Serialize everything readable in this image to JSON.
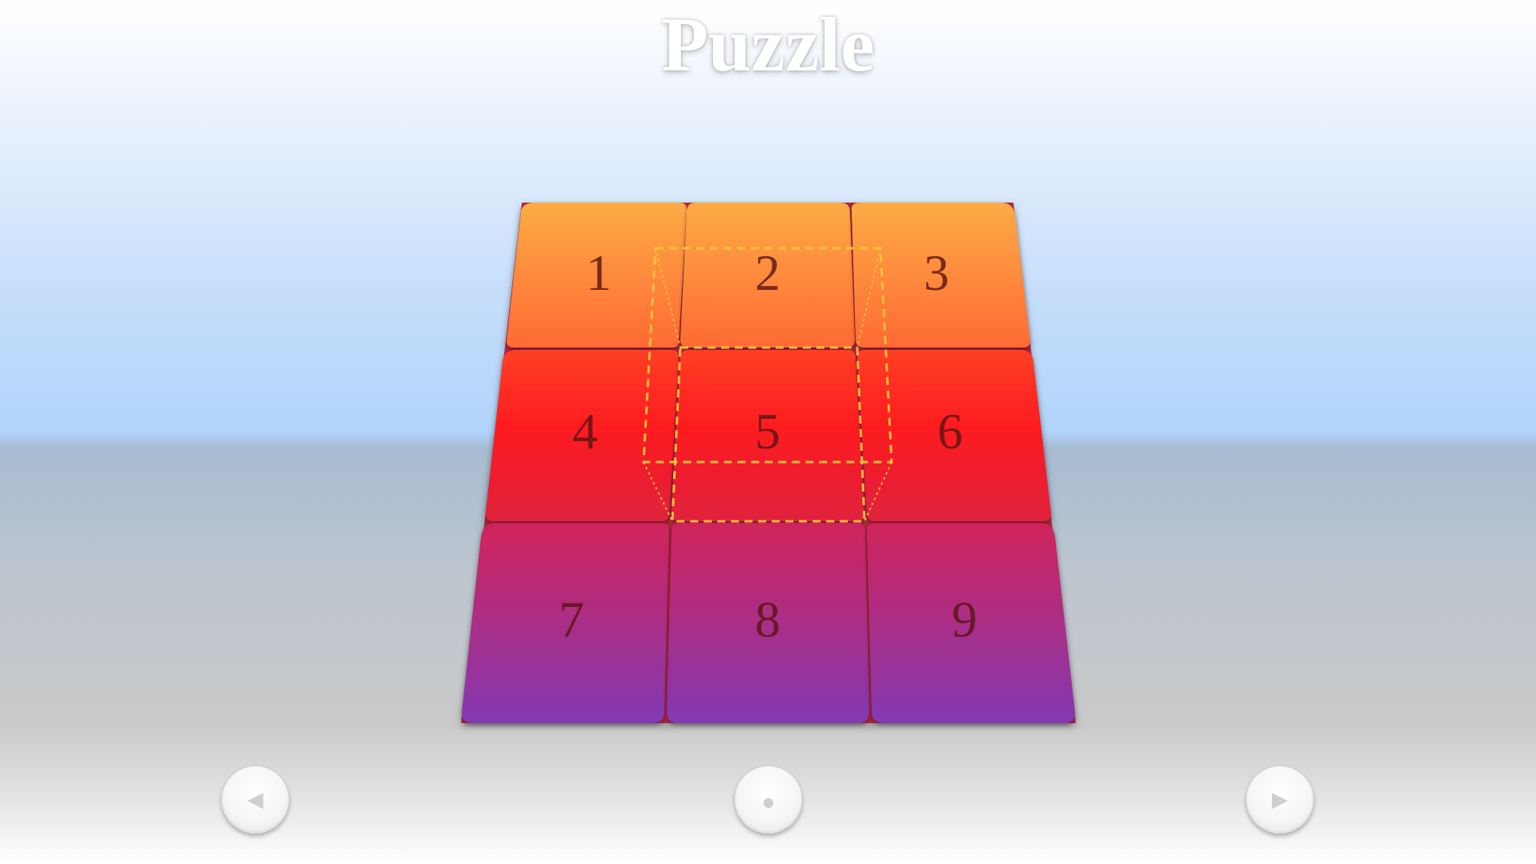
{
  "title": "Puzzle",
  "board": {
    "tiles": [
      {
        "label": "1"
      },
      {
        "label": "2"
      },
      {
        "label": "3"
      },
      {
        "label": "4"
      },
      {
        "label": "5"
      },
      {
        "label": "6"
      },
      {
        "label": "7"
      },
      {
        "label": "8"
      },
      {
        "label": "9"
      }
    ],
    "colors": {
      "orange_top": "#fcab45",
      "orange_bottom": "#ff6a34",
      "red_top": "#ff3f25",
      "red_mid": "#fd1c1f",
      "red_bottom": "#e0213d",
      "magenta_top": "#d1245a",
      "purple_bottom": "#8338b3",
      "number_color": "#5a1515",
      "highlight_cube": "#ffc53a"
    }
  },
  "controls": {
    "prev_icon": "◀",
    "center_icon": "●",
    "next_icon": "▶",
    "prev_icon_name": "triangle-left-icon",
    "center_icon_name": "dot-icon",
    "next_icon_name": "triangle-right-icon"
  }
}
